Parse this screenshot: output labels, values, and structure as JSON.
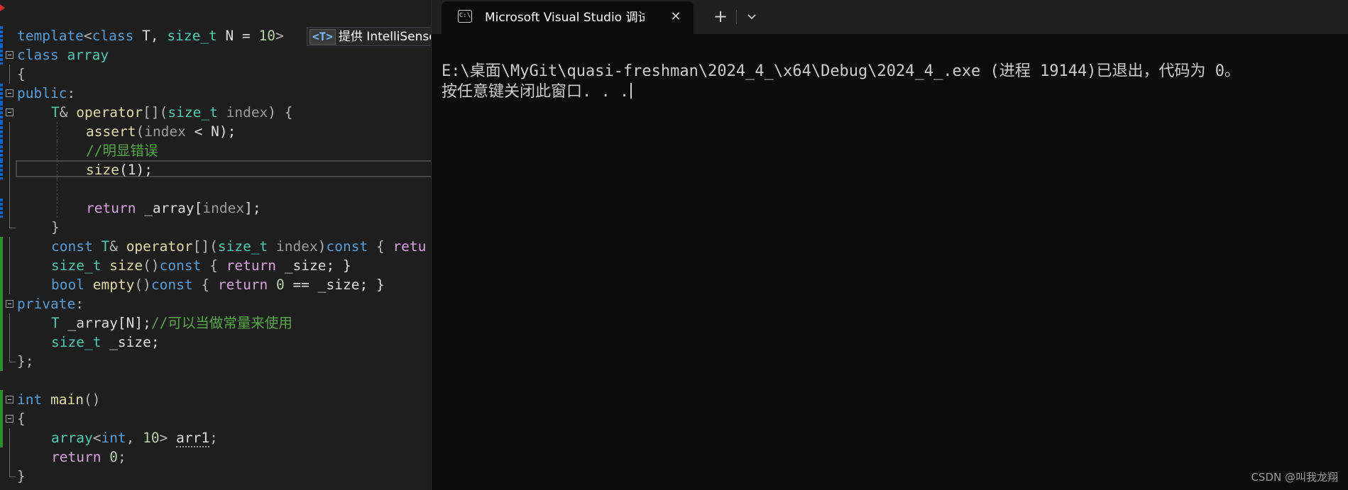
{
  "editor": {
    "tooltip": {
      "badge": "<T>",
      "text": "提供 IntelliSense"
    },
    "code": {
      "l1": [
        "template",
        "<",
        "class",
        " T, ",
        "size_t",
        " N = ",
        "10",
        ">"
      ],
      "l2": [
        "class",
        " ",
        "array"
      ],
      "l3": "{",
      "l4": [
        "public",
        ":"
      ],
      "l5": [
        "T",
        "& ",
        "operator",
        "[](",
        "size_t",
        " ",
        "index",
        ") {"
      ],
      "l6": [
        "assert",
        "(",
        "index",
        " < N);"
      ],
      "l7": "//明显错误",
      "l8": [
        "size",
        "(1);"
      ],
      "l9": "",
      "l10": [
        "return",
        " _array[",
        "index",
        "];"
      ],
      "l11": "}",
      "l12": [
        "const",
        " ",
        "T",
        "& ",
        "operator",
        "[](",
        "size_t",
        " ",
        "index",
        ")",
        "const",
        " { ",
        "retu"
      ],
      "l13": [
        "size_t",
        " ",
        "size",
        "()",
        "const",
        " { ",
        "return",
        " _size; }"
      ],
      "l14": [
        "bool",
        " ",
        "empty",
        "()",
        "const",
        " { ",
        "return",
        " ",
        "0",
        " == _size; }"
      ],
      "l15": [
        "private",
        ":"
      ],
      "l16": [
        "T",
        " _array[N];",
        "//可以当做常量来使用"
      ],
      "l17": [
        "size_t",
        " _size;"
      ],
      "l18": "};",
      "l19": "",
      "l20": [
        "int",
        " ",
        "main",
        "()"
      ],
      "l21": "{",
      "l22": [
        "array",
        "<",
        "int",
        ", ",
        "10",
        "> ",
        "arr1",
        ";"
      ],
      "l23": [
        "return",
        " ",
        "0",
        ";"
      ],
      "l24": "}"
    }
  },
  "terminal": {
    "tab_icon": "C:\\",
    "tab_title": "Microsoft Visual Studio 调试控制台",
    "close_icon": "✕",
    "new_tab_icon": "+",
    "dropdown_icon": "chevron-down",
    "output_line1": "E:\\桌面\\MyGit\\quasi-freshman\\2024_4_\\x64\\Debug\\2024_4_.exe (进程 19144)已退出，代码为 0。",
    "output_line2": "按任意键关闭此窗口. . ."
  },
  "watermark": "CSDN @叫我龙翔"
}
